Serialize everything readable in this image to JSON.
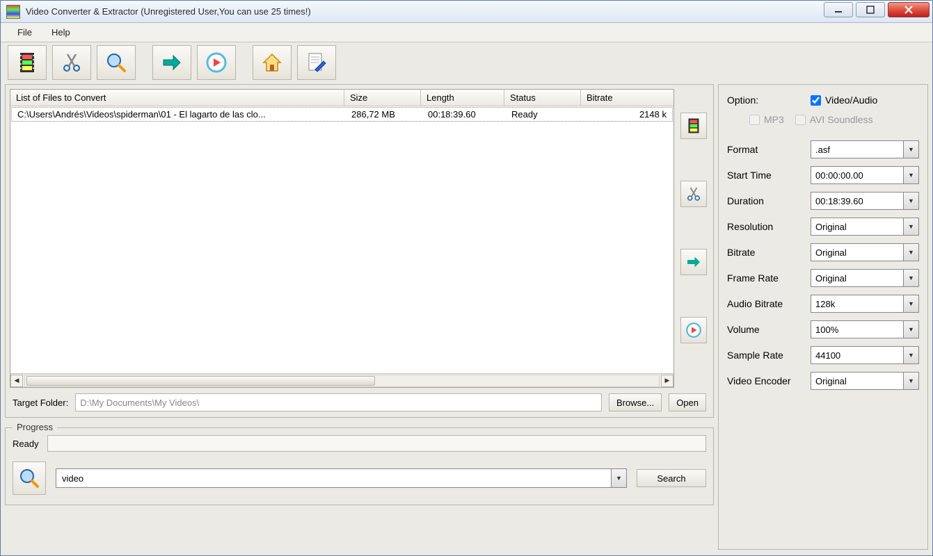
{
  "window": {
    "title": "Video Converter & Extractor (Unregistered User,You can use 25 times!)"
  },
  "menu": {
    "file": "File",
    "help": "Help"
  },
  "filelist": {
    "headers": {
      "file": "List of Files to Convert",
      "size": "Size",
      "length": "Length",
      "status": "Status",
      "bitrate": "Bitrate"
    },
    "row": {
      "file": "C:\\Users\\Andrés\\Videos\\spiderman\\01 - El lagarto de las clo...",
      "size": "286,72 MB",
      "length": "00:18:39.60",
      "status": "Ready",
      "bitrate": "2148 k"
    }
  },
  "target": {
    "label": "Target Folder:",
    "value": "D:\\My Documents\\My Videos\\",
    "browse": "Browse...",
    "open": "Open"
  },
  "progress": {
    "legend": "Progress",
    "status": "Ready",
    "search_value": "video",
    "search_btn": "Search"
  },
  "options": {
    "option_label": "Option:",
    "video_audio": "Video/Audio",
    "mp3": "MP3",
    "avi_soundless": "AVI Soundless",
    "fields": {
      "format_label": "Format",
      "format_value": ".asf",
      "start_time_label": "Start Time",
      "start_time_value": "00:00:00.00",
      "duration_label": "Duration",
      "duration_value": "00:18:39.60",
      "resolution_label": "Resolution",
      "resolution_value": "Original",
      "bitrate_label": "Bitrate",
      "bitrate_value": "Original",
      "frame_rate_label": "Frame Rate",
      "frame_rate_value": "Original",
      "audio_bitrate_label": "Audio Bitrate",
      "audio_bitrate_value": "128k",
      "volume_label": "Volume",
      "volume_value": "100%",
      "sample_rate_label": "Sample Rate",
      "sample_rate_value": "44100",
      "video_encoder_label": "Video Encoder",
      "video_encoder_value": "Original"
    }
  }
}
